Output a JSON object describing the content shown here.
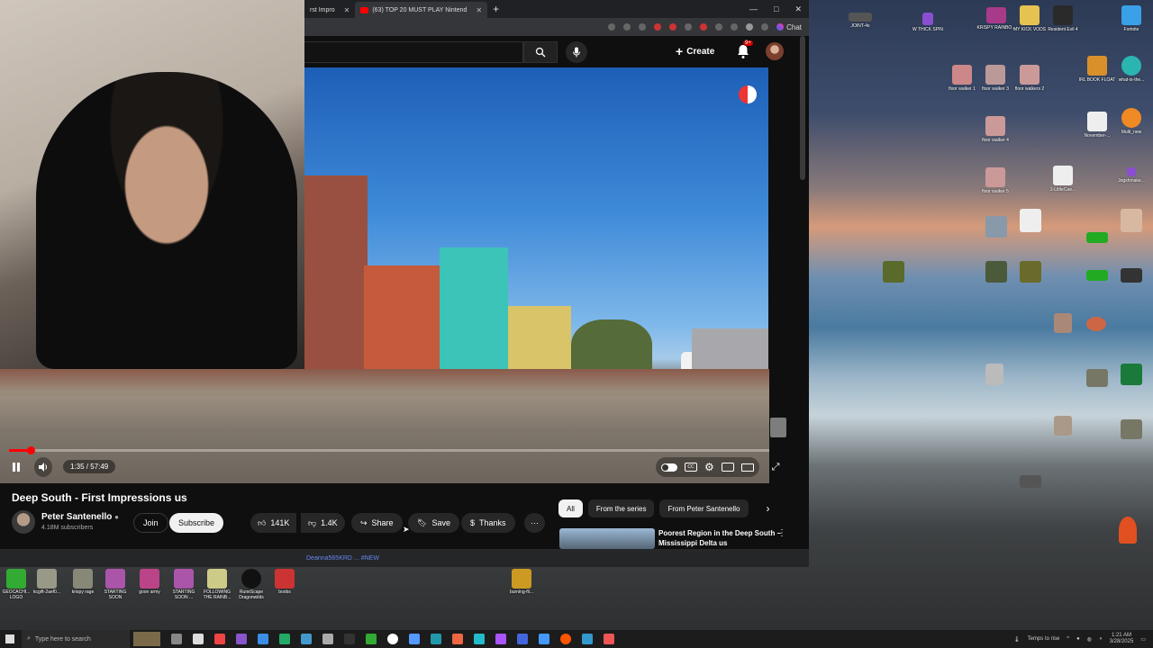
{
  "browser": {
    "tabs": [
      {
        "label": "rst Impro",
        "active": false
      },
      {
        "label": "(63) TOP 20 MUST PLAY Nintend",
        "active": true
      }
    ],
    "new_tab": "+",
    "win_min": "—",
    "win_max": "□",
    "win_close": "✕",
    "chat_label": "Chat"
  },
  "youtube": {
    "create_label": "Create",
    "notif_badge": "9+",
    "video": {
      "time": "1:35 / 57:49",
      "progress_fraction": 0.028
    },
    "title": "Deep South - First Impressions us",
    "channel": {
      "name": "Peter Santenello",
      "subs": "4.18M subscribers"
    },
    "actions": {
      "join": "Join",
      "subscribe": "Subscribe",
      "likes": "141K",
      "dislikes": "1.4K",
      "share": "Share",
      "save": "Save",
      "thanks": "Thanks",
      "more": "···"
    },
    "chips": [
      "All",
      "From the series",
      "From Peter Santenello"
    ],
    "recommendation": {
      "title": "Poorest Region in the Deep South – Mississippi Delta us"
    }
  },
  "desktop_icons": [
    {
      "label": "JOINT-4x"
    },
    {
      "label": "W THICK SPIN"
    },
    {
      "label": "KRISPY RAINBO..."
    },
    {
      "label": "MY KICK VODS"
    },
    {
      "label": "Resident Evil 4"
    },
    {
      "label": "Fortnite"
    },
    {
      "label": "floor walker 1"
    },
    {
      "label": "floor walker 3"
    },
    {
      "label": "floor walkers 2"
    },
    {
      "label": "IRL BOOK FLOAT"
    },
    {
      "label": "what-is-the..."
    },
    {
      "label": "floor walker 4"
    },
    {
      "label": "November-..."
    },
    {
      "label": "Multi_new"
    },
    {
      "label": "floor walker 5"
    },
    {
      "label": "2-LittleCae..."
    },
    {
      "label": "Jogshmake..."
    }
  ],
  "stream_bar": {
    "text": "Deanna565KRD ... #NEW"
  },
  "bottom_icons": [
    {
      "label": "GEOCACHI... LOGO"
    },
    {
      "label": "kcgift-2aef0..."
    },
    {
      "label": "krispy rage"
    },
    {
      "label": "STARTING SOON"
    },
    {
      "label": "goon army"
    },
    {
      "label": "STARTING SOON ..."
    },
    {
      "label": "FOLLOWING THE RAINB..."
    },
    {
      "label": "RuneScape Dragonwilds"
    },
    {
      "label": "boobs"
    },
    {
      "label": "burning-fli..."
    }
  ],
  "taskbar": {
    "search_placeholder": "Type here to search",
    "tray_text": "Temps to rise",
    "clock_time": "1:21 AM",
    "clock_date": "3/28/2025"
  }
}
